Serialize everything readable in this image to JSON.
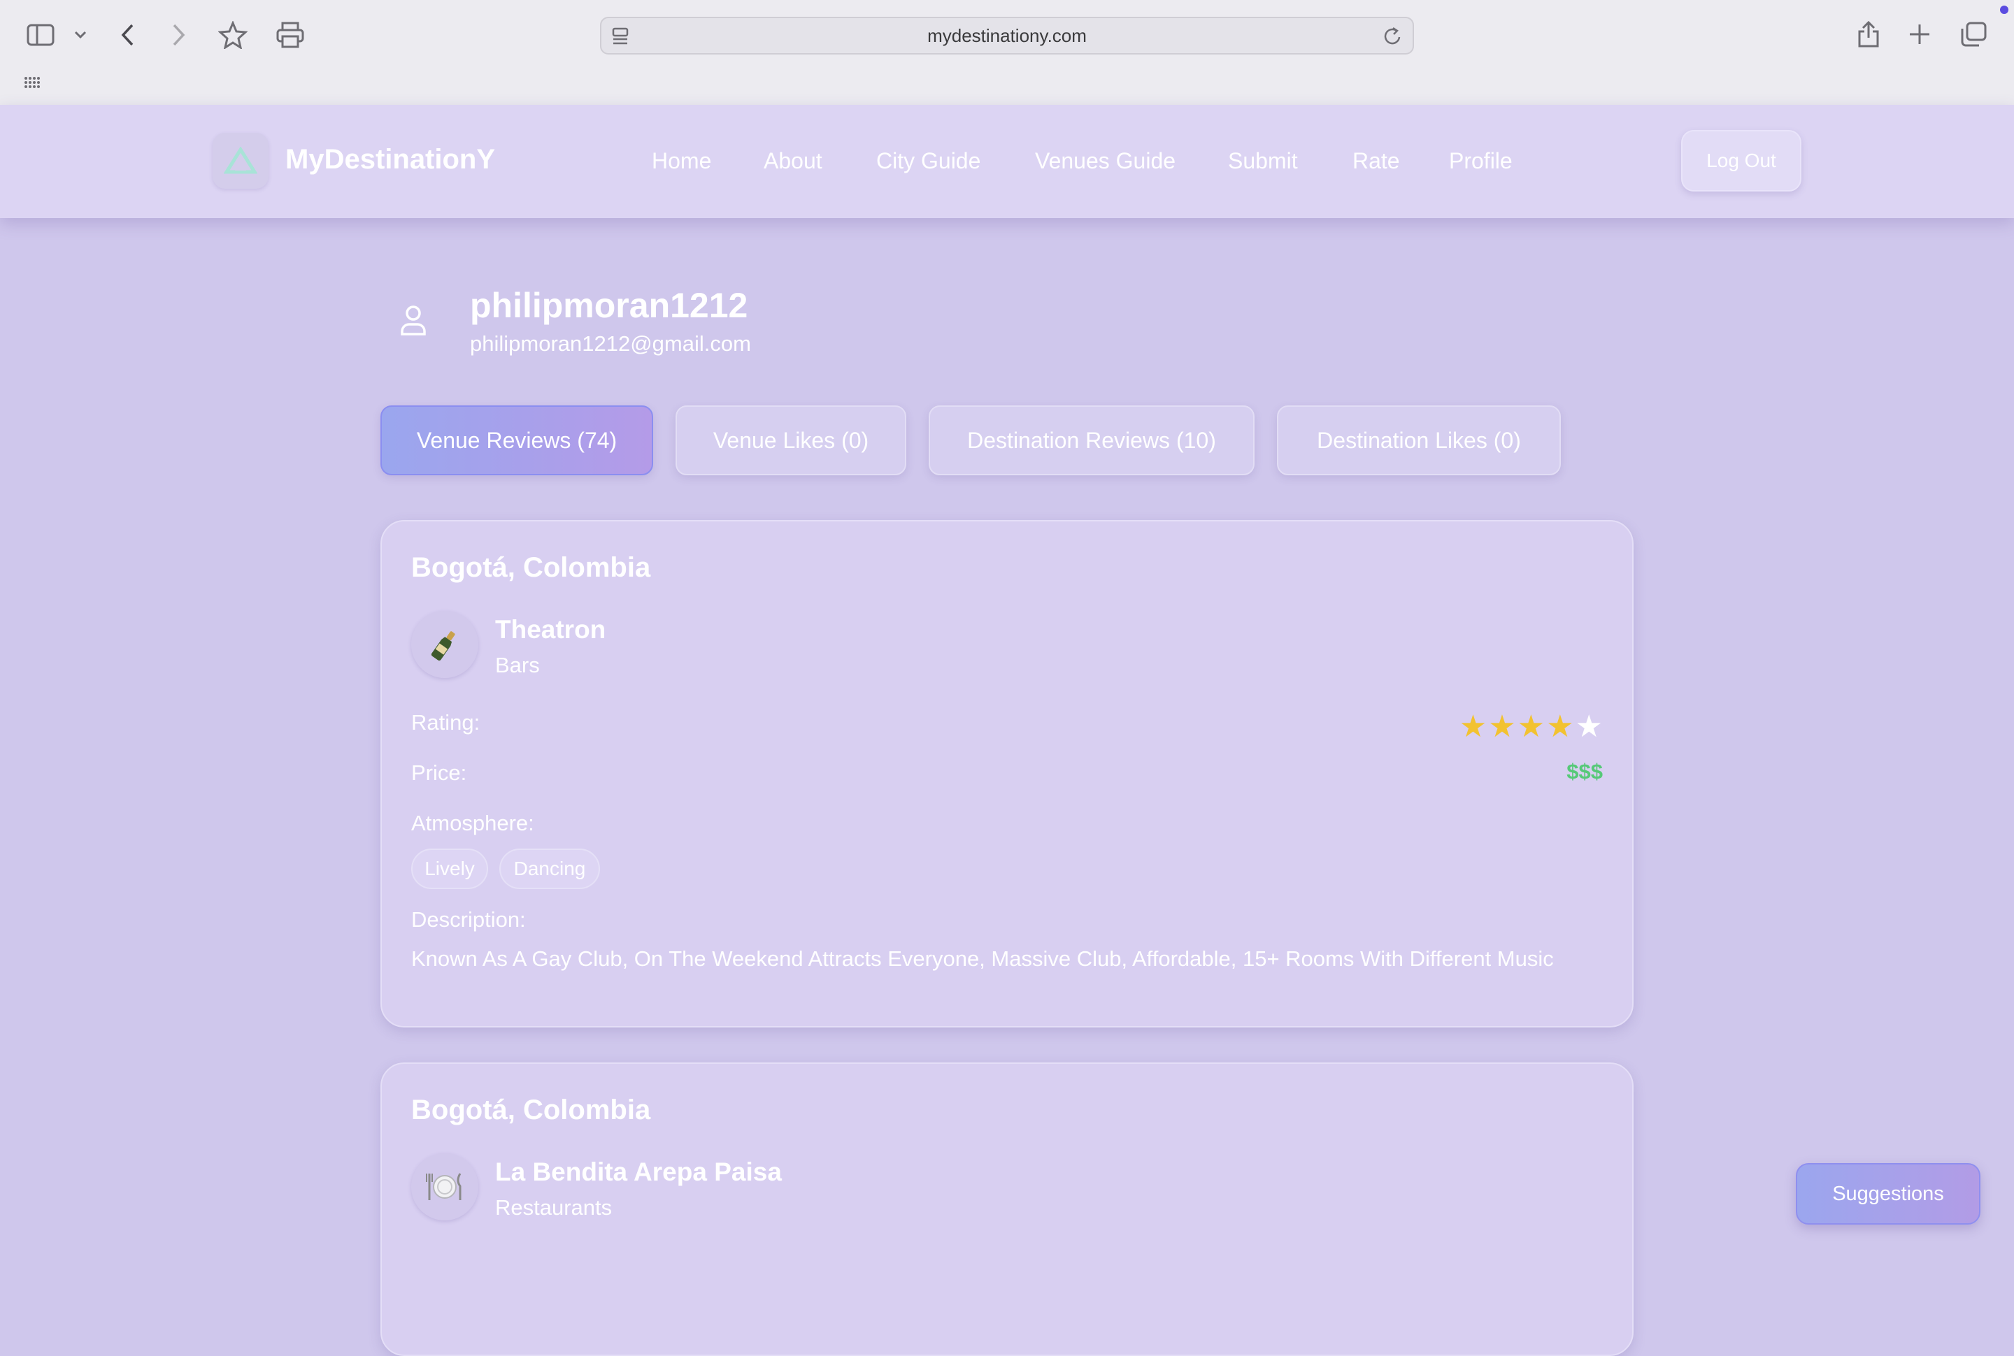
{
  "browser": {
    "url": "mydestinationy.com"
  },
  "header": {
    "brand": "MyDestinationY",
    "nav": [
      "Home",
      "About",
      "City Guide",
      "Venues Guide",
      "Submit",
      "Rate",
      "Profile"
    ],
    "logout_label": "Log Out"
  },
  "profile": {
    "username": "philipmoran1212",
    "email": "philipmoran1212@gmail.com",
    "tabs": [
      {
        "label": "Venue Reviews (74)",
        "active": true
      },
      {
        "label": "Venue Likes (0)",
        "active": false
      },
      {
        "label": "Destination Reviews (10)",
        "active": false
      },
      {
        "label": "Destination Likes (0)",
        "active": false
      }
    ]
  },
  "labels": {
    "rating": "Rating:",
    "price": "Price:",
    "atmosphere": "Atmosphere:",
    "description": "Description:"
  },
  "reviews": [
    {
      "city": "Bogotá, Colombia",
      "venue": "Theatron",
      "category": "Bars",
      "icon": "bottle-icon",
      "rating": 4,
      "rating_max": 5,
      "price": "$$$",
      "atmosphere": [
        "Lively",
        "Dancing"
      ],
      "description": "Known As A Gay Club, On The Weekend Attracts Everyone, Massive Club, Affordable, 15+ Rooms With Different Music"
    },
    {
      "city": "Bogotá, Colombia",
      "venue": "La Bendita Arepa Paisa",
      "category": "Restaurants",
      "icon": "plate-icon"
    }
  ],
  "suggestions_label": "Suggestions",
  "colors": {
    "background": "#cfc7ec",
    "star_filled": "#f2c230",
    "star_empty": "#ffffff",
    "price": "#56c978",
    "active_tab_start": "#9aa6ee",
    "active_tab_end": "#b49be8"
  }
}
